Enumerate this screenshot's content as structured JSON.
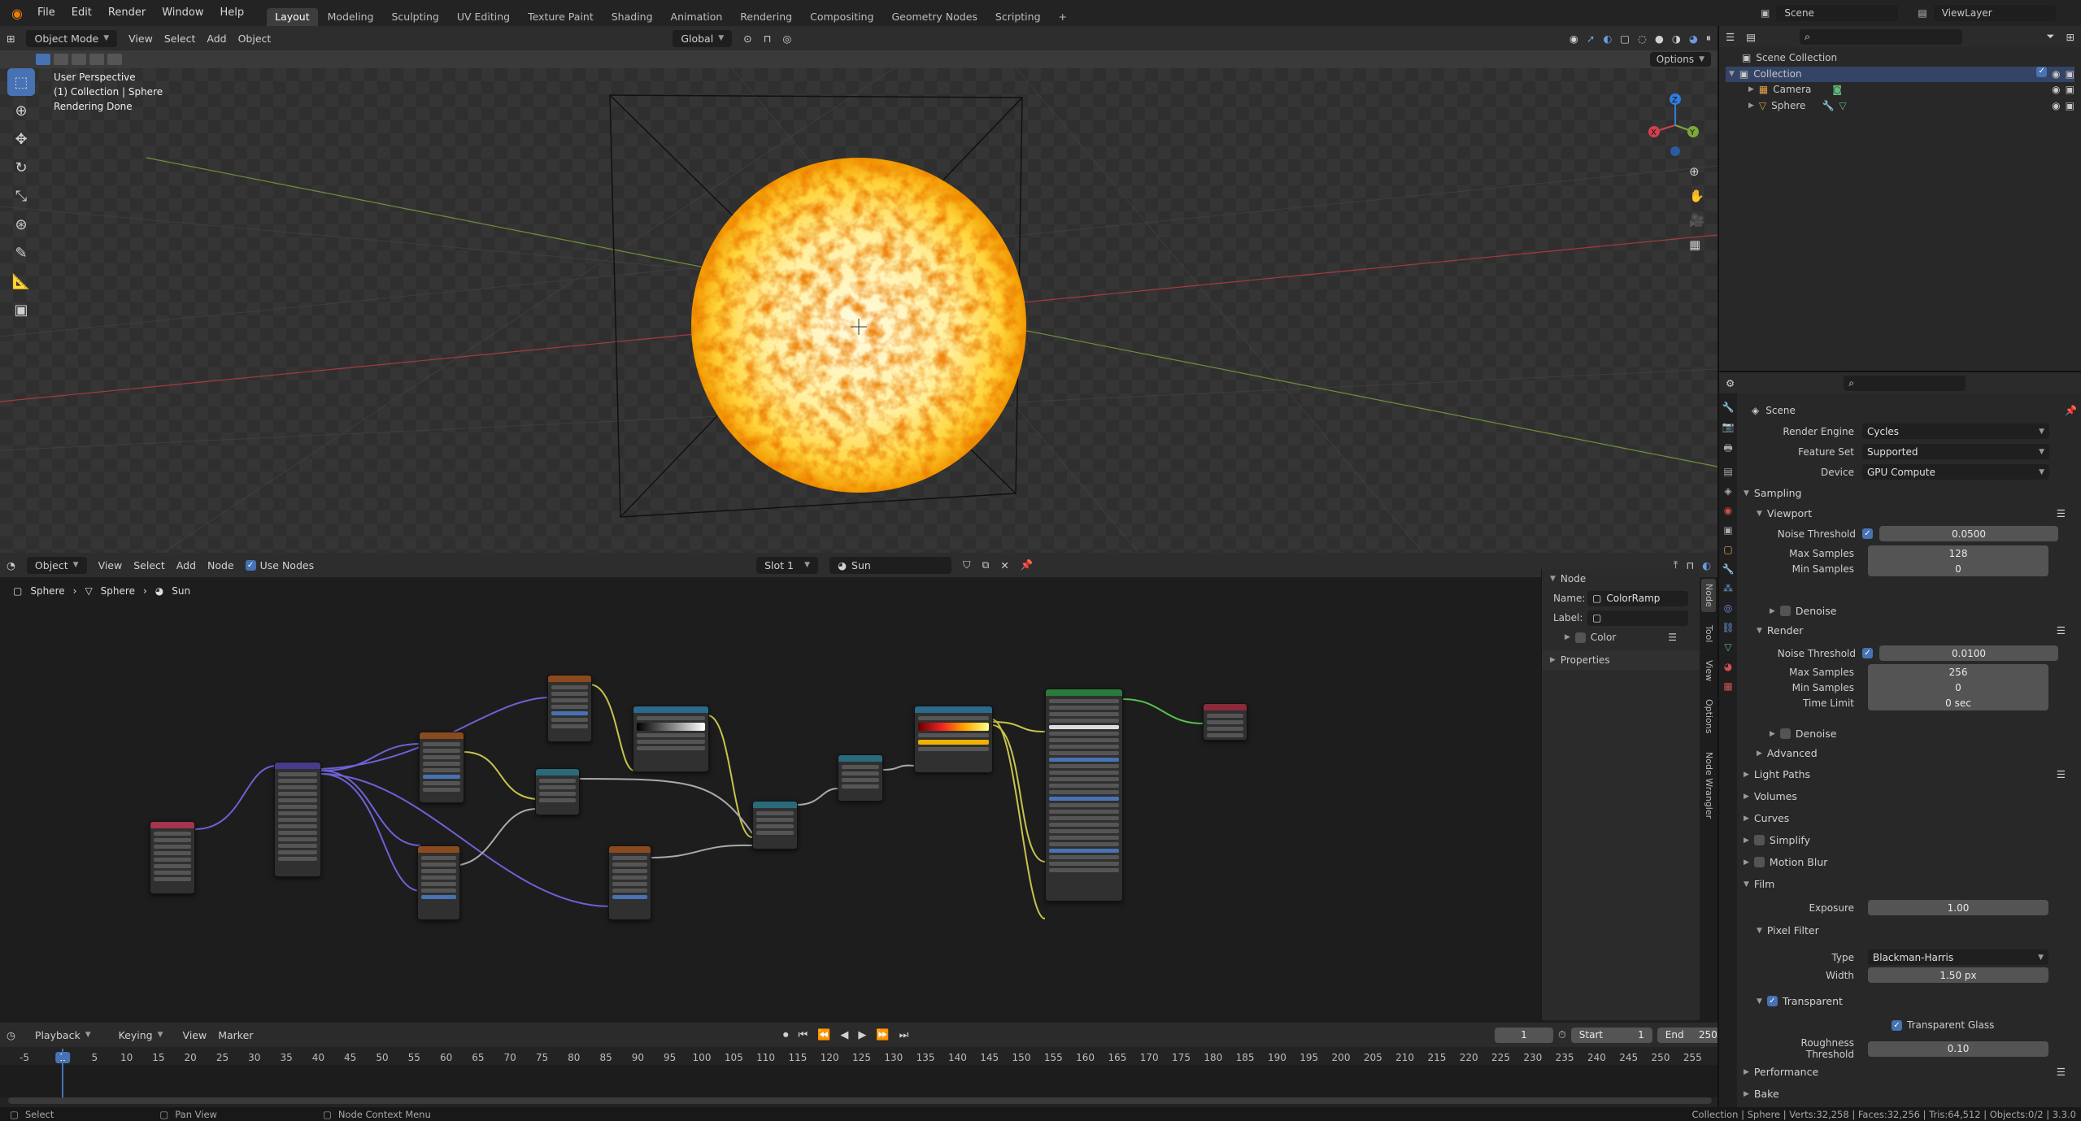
{
  "topbar": {
    "menus": [
      "File",
      "Edit",
      "Render",
      "Window",
      "Help"
    ],
    "workspaces": [
      "Layout",
      "Modeling",
      "Sculpting",
      "UV Editing",
      "Texture Paint",
      "Shading",
      "Animation",
      "Rendering",
      "Compositing",
      "Geometry Nodes",
      "Scripting"
    ],
    "active_workspace": "Layout",
    "scene": "Scene",
    "view_layer": "ViewLayer"
  },
  "viewport": {
    "mode": "Object Mode",
    "menus": [
      "View",
      "Select",
      "Add",
      "Object"
    ],
    "transform_orientation": "Global",
    "options_label": "Options",
    "overlay_lines": [
      "User Perspective",
      "(1) Collection | Sphere",
      "Rendering Done"
    ]
  },
  "node_editor": {
    "type_dropdown": "Object",
    "menus": [
      "View",
      "Select",
      "Add",
      "Node"
    ],
    "use_nodes_label": "Use Nodes",
    "slot": "Slot 1",
    "material": "Sun",
    "breadcrumb": [
      "Sphere",
      "Sphere",
      "Sun"
    ],
    "sidebar": {
      "section_node": "Node",
      "name_label": "Name:",
      "name_value": "ColorRamp",
      "label_label": "Label:",
      "label_value": "",
      "color_label": "Color",
      "properties_label": "Properties",
      "tabs": [
        "Node",
        "Tool",
        "View",
        "Options",
        "Node Wrangler"
      ]
    }
  },
  "timeline": {
    "menus": [
      "Playback",
      "Keying",
      "View",
      "Marker"
    ],
    "current_frame": "1",
    "start_label": "Start",
    "start": "1",
    "end_label": "End",
    "end": "250",
    "ticks": [
      "-5",
      "1",
      "5",
      "10",
      "15",
      "20",
      "25",
      "30",
      "35",
      "40",
      "45",
      "50",
      "55",
      "60",
      "65",
      "70",
      "75",
      "80",
      "85",
      "90",
      "95",
      "100",
      "105",
      "110",
      "115",
      "120",
      "125",
      "130",
      "135",
      "140",
      "145",
      "150",
      "155",
      "160",
      "165",
      "170",
      "175",
      "180",
      "185",
      "190",
      "195",
      "200",
      "205",
      "210",
      "215",
      "220",
      "225",
      "230",
      "235",
      "240",
      "245",
      "250",
      "255"
    ]
  },
  "outliner": {
    "root": "Scene Collection",
    "collection": "Collection",
    "items": [
      "Camera",
      "Sphere"
    ]
  },
  "properties": {
    "context": "Scene",
    "render_engine_label": "Render Engine",
    "render_engine": "Cycles",
    "feature_set_label": "Feature Set",
    "feature_set": "Supported",
    "device_label": "Device",
    "device": "GPU Compute",
    "sampling": "Sampling",
    "viewport": "Viewport",
    "noise_threshold_label": "Noise Threshold",
    "vp_noise_threshold": "0.0500",
    "max_samples_label": "Max Samples",
    "vp_max_samples": "128",
    "min_samples_label": "Min Samples",
    "vp_min_samples": "0",
    "denoise": "Denoise",
    "render": "Render",
    "r_noise_threshold": "0.0100",
    "r_max_samples": "256",
    "r_min_samples": "0",
    "time_limit_label": "Time Limit",
    "time_limit": "0 sec",
    "advanced": "Advanced",
    "light_paths": "Light Paths",
    "volumes": "Volumes",
    "curves": "Curves",
    "simplify": "Simplify",
    "motion_blur": "Motion Blur",
    "film": "Film",
    "exposure_label": "Exposure",
    "exposure": "1.00",
    "pixel_filter": "Pixel Filter",
    "type_label": "Type",
    "filter_type": "Blackman-Harris",
    "width_label": "Width",
    "width": "1.50 px",
    "transparent": "Transparent",
    "transparent_glass": "Transparent Glass",
    "roughness_threshold_label": "Roughness Threshold",
    "roughness_threshold": "0.10",
    "performance": "Performance",
    "bake": "Bake"
  },
  "statusbar": {
    "select": "Select",
    "pan_view": "Pan View",
    "context_menu": "Node Context Menu",
    "stats": "Collection | Sphere | Verts:32,258 | Faces:32,256 | Tris:64,512 | Objects:0/2 | 3.3.0"
  },
  "colors": {
    "accent": "#4772b3",
    "sun_core": "#fff2a0",
    "sun_edge": "#f5a300",
    "x_axis": "#c43b48",
    "y_axis": "#7ea83a"
  }
}
